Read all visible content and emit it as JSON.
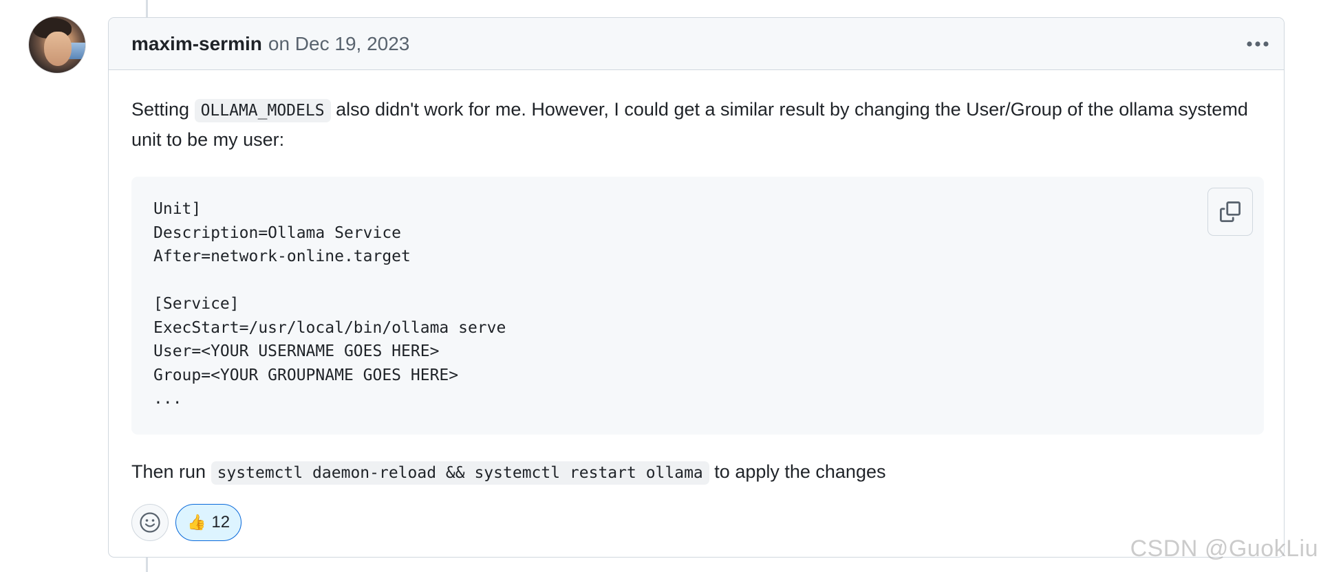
{
  "comment": {
    "author": "maxim-sermin",
    "meta": "on Dec 19, 2023",
    "more_icon": "kebab-horizontal-icon",
    "body": {
      "para1_before": "Setting ",
      "para1_code": "OLLAMA_MODELS",
      "para1_after": " also didn't work for me. However, I could get a similar result by changing the User/Group of the ollama systemd unit to be my user:",
      "code_lines": [
        "Unit]",
        "Description=Ollama Service",
        "After=network-online.target",
        "",
        "[Service]",
        "ExecStart=/usr/local/bin/ollama serve",
        "User=<YOUR USERNAME GOES HERE>",
        "Group=<YOUR GROUPNAME GOES HERE>",
        "..."
      ],
      "copy_icon": "copy-icon",
      "para2_before": "Then run ",
      "para2_code": "systemctl daemon-reload && systemctl restart ollama",
      "para2_after": " to apply the changes"
    },
    "reactions": {
      "add_icon": "smiley-icon",
      "thumbs_up_emoji": "👍",
      "thumbs_up_count": "12"
    }
  },
  "watermark": "CSDN @GuokLiu",
  "colors": {
    "accent": "#0969da",
    "reaction_bg": "#ddf4ff",
    "header_bg": "#f6f8fa",
    "border": "#d0d7de"
  }
}
